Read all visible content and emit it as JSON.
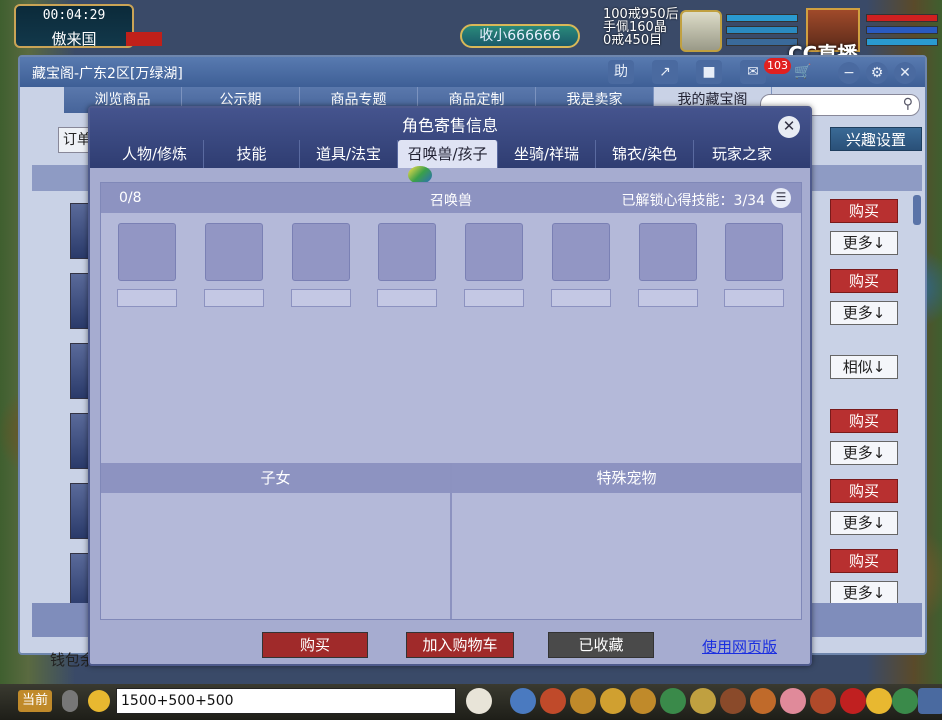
{
  "hud": {
    "time": "00:04:29",
    "map_name": "傲来国",
    "gold_label": "收小666666",
    "info_lines": [
      "100戒950后",
      "手佩160晶",
      "0戒450目"
    ],
    "cc_logo": "CC直播"
  },
  "shop": {
    "title": "藏宝阁-广东2区[万绿湖]",
    "notification_count": "103",
    "tabs": [
      "浏览商品",
      "公示期",
      "商品专题",
      "商品定制",
      "我是卖家",
      "我的藏宝阁"
    ],
    "active_tab": "我的藏宝阁",
    "order_button": "订单",
    "interest_button": "兴趣设置",
    "wallet_label": "钱包余",
    "row_buttons": [
      {
        "primary": "购买",
        "secondary": "更多↓"
      },
      {
        "primary": "购买",
        "secondary": "更多↓"
      },
      {
        "primary": "",
        "secondary": "相似↓"
      },
      {
        "primary": "购买",
        "secondary": "更多↓"
      },
      {
        "primary": "购买",
        "secondary": "更多↓"
      },
      {
        "primary": "购买",
        "secondary": "更多↓"
      }
    ]
  },
  "modal": {
    "title": "角色寄售信息",
    "tabs": [
      "人物/修炼",
      "技能",
      "道具/法宝",
      "召唤兽/孩子",
      "坐骑/祥瑞",
      "锦衣/染色",
      "玩家之家"
    ],
    "active_tab": "召唤兽/孩子",
    "pet_count": "0/8",
    "pet_section_title": "召唤兽",
    "skill_unlock": "已解锁心得技能：3/34",
    "children_title": "子女",
    "special_pets_title": "特殊宠物",
    "buy_button": "购买",
    "add_cart_button": "加入购物车",
    "saved_button": "已收藏",
    "web_link": "使用网页版"
  },
  "chat": {
    "channel": "当前",
    "input_value": "1500+500+500"
  },
  "colors": {
    "buy_red": "#b83030",
    "modal_header": "#2f3d72",
    "link_blue": "#1a2ee0"
  }
}
